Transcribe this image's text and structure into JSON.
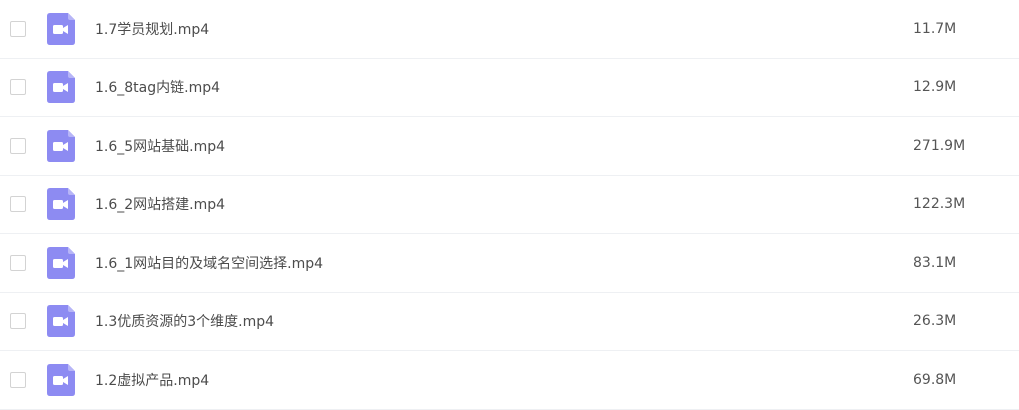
{
  "colors": {
    "icon_fill": "#8d8bf2",
    "icon_fold": "#b7b5f7",
    "divider": "#eef0f3",
    "text": "#4c4c4c"
  },
  "files": [
    {
      "name": "1.7学员规划.mp4",
      "size": "11.7M",
      "icon": "video-file-icon"
    },
    {
      "name": "1.6_8tag内链.mp4",
      "size": "12.9M",
      "icon": "video-file-icon"
    },
    {
      "name": "1.6_5网站基础.mp4",
      "size": "271.9M",
      "icon": "video-file-icon"
    },
    {
      "name": "1.6_2网站搭建.mp4",
      "size": "122.3M",
      "icon": "video-file-icon"
    },
    {
      "name": "1.6_1网站目的及域名空间选择.mp4",
      "size": "83.1M",
      "icon": "video-file-icon"
    },
    {
      "name": "1.3优质资源的3个维度.mp4",
      "size": "26.3M",
      "icon": "video-file-icon"
    },
    {
      "name": "1.2虚拟产品.mp4",
      "size": "69.8M",
      "icon": "video-file-icon"
    }
  ]
}
